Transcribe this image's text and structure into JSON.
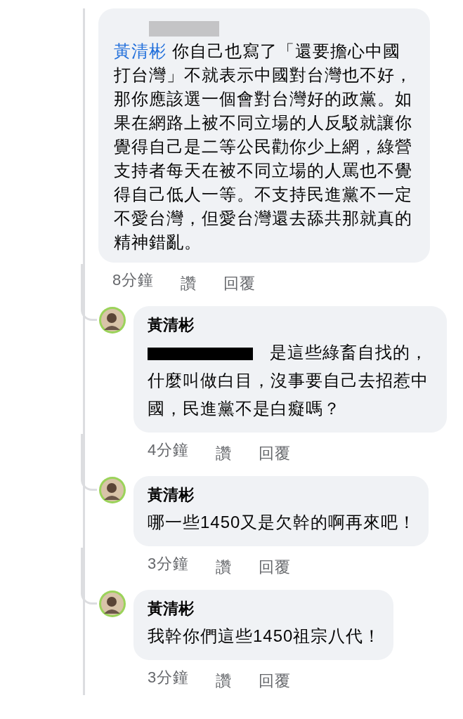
{
  "comment": {
    "author_redacted": true,
    "mention": "黃清彬",
    "text": "你自己也寫了「還要擔心中國打台灣」不就表示中國對台灣也不好，那你應該選一個會對台灣好的政黨。如果在網路上被不同立場的人反駁就讓你覺得自己是二等公民勸你少上網，綠營支持者每天在被不同立場的人罵也不覺得自己低人一等。不支持民進黨不一定不愛台灣，但愛台灣還去舔共那就真的精神錯亂。",
    "time": "8分鐘",
    "like": "讚",
    "reply": "回覆"
  },
  "replies": [
    {
      "author": "黃清彬",
      "redacted_mention": true,
      "text": "是這些綠畜自找的，什麼叫做白目，沒事要自己去招惹中國，民進黨不是白癡嗎？",
      "time": "4分鐘",
      "like": "讚",
      "reply": "回覆"
    },
    {
      "author": "黃清彬",
      "redacted_mention": false,
      "text": "哪一些1450又是欠幹的啊再來吧！",
      "time": "3分鐘",
      "like": "讚",
      "reply": "回覆"
    },
    {
      "author": "黃清彬",
      "redacted_mention": false,
      "text": "我幹你們這些1450祖宗八代！",
      "time": "3分鐘",
      "like": "讚",
      "reply": "回覆"
    }
  ]
}
